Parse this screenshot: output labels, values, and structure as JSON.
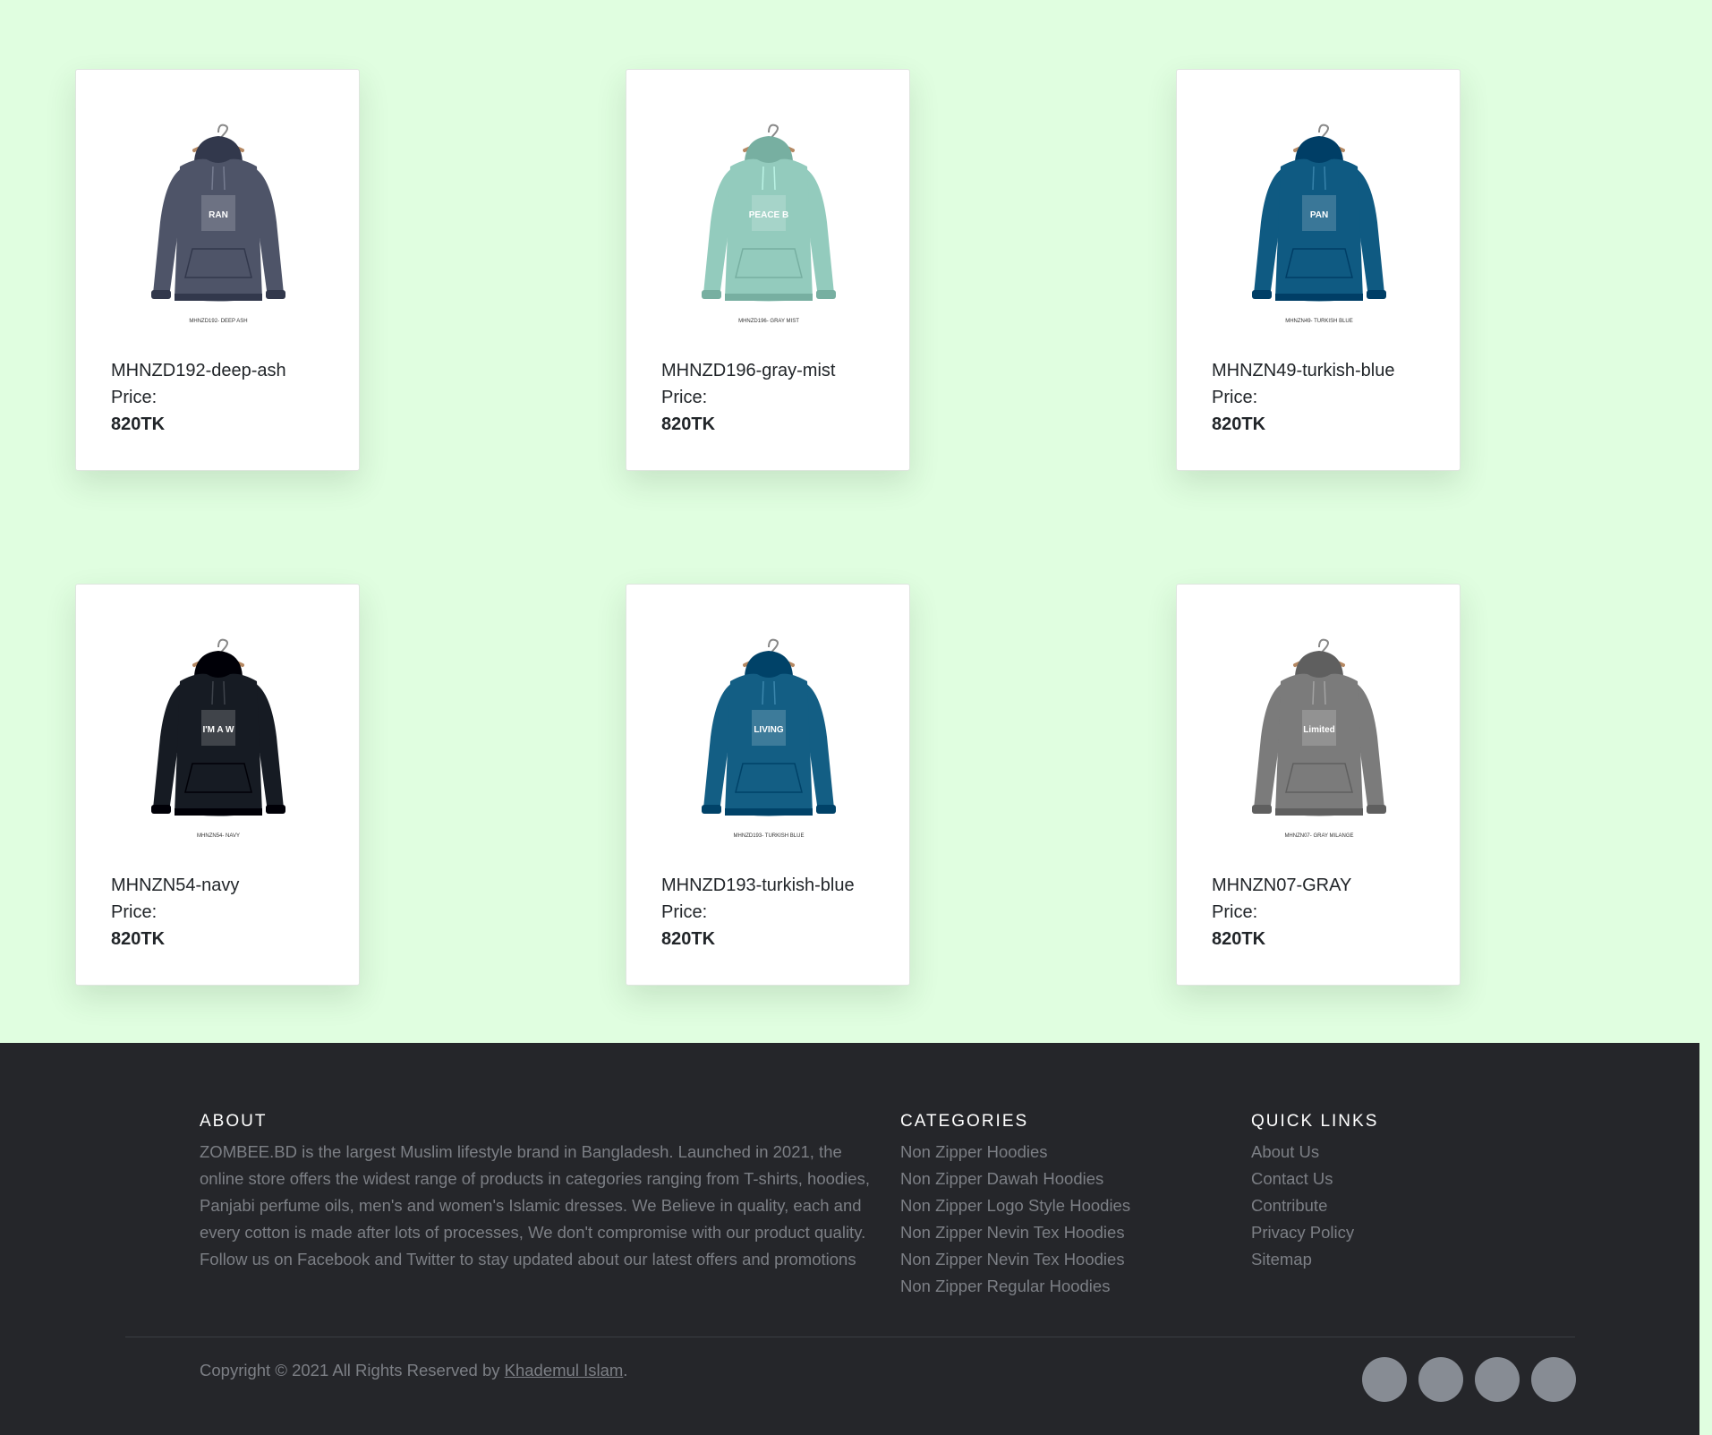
{
  "products": [
    {
      "name": "MHNZD192-deep-ash",
      "price_label": "Price:",
      "price": "820TK",
      "color": "#4e5468",
      "image_caption": "MHNZD192- DEEP ASH",
      "print": "RAN"
    },
    {
      "name": "MHNZD196-gray-mist",
      "price_label": "Price:",
      "price": "820TK",
      "color": "#93cbbd",
      "image_caption": "MHNZD196- GRAY MIST",
      "print": "PEACE BE UPON YOU"
    },
    {
      "name": "MHNZN49-turkish-blue",
      "price_label": "Price:",
      "price": "820TK",
      "color": "#0f5a82",
      "image_caption": "MHNZN49- TURKISH BLUE",
      "print": "PAN"
    },
    {
      "name": "MHNZN54-navy",
      "price_label": "Price:",
      "price": "820TK",
      "color": "#161b23",
      "image_caption": "MHNZN54- NAVY",
      "print": "I'M A WRITER I DREAM WHILE AWAKE"
    },
    {
      "name": "MHNZD193-turkish-blue",
      "price_label": "Price:",
      "price": "820TK",
      "color": "#135e84",
      "image_caption": "MHNZD193- TURKISH BLUE",
      "print": "LIVING"
    },
    {
      "name": "MHNZN07-GRAY",
      "price_label": "Price:",
      "price": "820TK",
      "color": "#7b7b7b",
      "image_caption": "MHNZN07- GRAY MILANGE",
      "print": "Limited"
    }
  ],
  "footer": {
    "about": {
      "title": "ABOUT",
      "text": "ZOMBEE.BD is the largest Muslim lifestyle brand in Bangladesh. Launched in 2021, the online store offers the widest range of products in categories ranging from T-shirts, hoodies, Panjabi perfume oils, men's and women's Islamic dresses. We Believe in quality, each and every cotton is made after lots of processes, We don't compromise with our product quality. Follow us on Facebook and Twitter to stay updated about our latest offers and promotions"
    },
    "categories": {
      "title": "CATEGORIES",
      "items": [
        "Non Zipper Hoodies",
        "Non Zipper Dawah Hoodies",
        "Non Zipper Logo Style Hoodies",
        "Non Zipper Nevin Tex Hoodies",
        "Non Zipper Nevin Tex Hoodies",
        "Non Zipper Regular Hoodies"
      ]
    },
    "quick_links": {
      "title": "QUICK LINKS",
      "items": [
        "About Us",
        "Contact Us",
        "Contribute",
        "Privacy Policy",
        "Sitemap"
      ]
    },
    "copyright": {
      "prefix": "Copyright © 2021 All Rights Reserved by",
      "author": "Khademul Islam",
      "suffix": "."
    },
    "social": [
      "facebook-icon",
      "twitter-icon",
      "instagram-icon",
      "linkedin-icon"
    ]
  },
  "colors": {
    "page_bg": "#e0fee0",
    "footer_bg": "#25262a",
    "muted_text": "#7c7f85",
    "social_bg": "#878c94"
  }
}
